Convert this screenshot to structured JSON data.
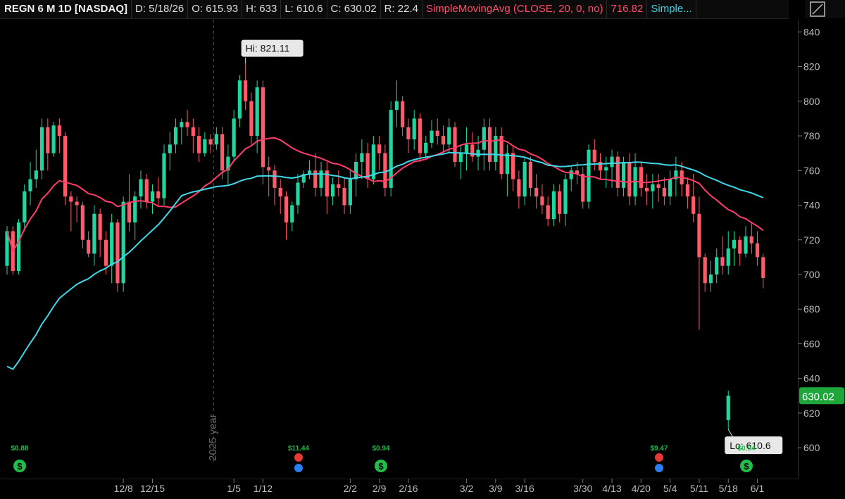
{
  "header": {
    "symbol": "REGN 6 M 1D [NASDAQ]",
    "date": "D: 5/18/26",
    "open": "O: 615.93",
    "high": "H: 633",
    "low": "L: 610.6",
    "close": "C: 630.02",
    "range": "R: 22.4",
    "sma20_label": "SimpleMovingAvg (CLOSE, 20, 0, no)",
    "sma20_value": "716.82",
    "sma50_label": "Simple..."
  },
  "colors": {
    "up": "#1fd6a0",
    "down": "#ff5a6a",
    "sma20": "#ff3d6a",
    "sma50": "#3fd8e8",
    "last_price_bg": "#1fa63a",
    "event_green": "#1fbf4a",
    "event_red": "#e53935",
    "event_blue": "#2a7ff0"
  },
  "chart_data": {
    "type": "candlestick",
    "ylim": [
      595,
      845
    ],
    "y_ticks": [
      600,
      620,
      640,
      660,
      680,
      700,
      720,
      740,
      760,
      780,
      800,
      820,
      840
    ],
    "x_ticks": [
      {
        "label": "12/8",
        "i": 20
      },
      {
        "label": "12/15",
        "i": 25
      },
      {
        "label": "1/5",
        "i": 39
      },
      {
        "label": "1/12",
        "i": 44
      },
      {
        "label": "2/2",
        "i": 59
      },
      {
        "label": "2/9",
        "i": 64
      },
      {
        "label": "2/16",
        "i": 69
      },
      {
        "label": "3/2",
        "i": 79
      },
      {
        "label": "3/9",
        "i": 84
      },
      {
        "label": "3/16",
        "i": 89
      },
      {
        "label": "3/30",
        "i": 99
      },
      {
        "label": "4/13",
        "i": 104
      },
      {
        "label": "4/20",
        "i": 109
      },
      {
        "label": "5/4",
        "i": 114
      },
      {
        "label": "5/11",
        "i": 119
      },
      {
        "label": "5/18",
        "i": 124
      },
      {
        "label": "6/1",
        "i": 129
      }
    ],
    "year_label": "2025 year",
    "year_divider_i": 35.5,
    "hi_label": "Hi: 821.11",
    "lo_label": "Lo: 610.6",
    "last_price": "630.02",
    "candles": [
      [
        705,
        728,
        700,
        725
      ],
      [
        725,
        728,
        700,
        702
      ],
      [
        702,
        732,
        700,
        730
      ],
      [
        730,
        752,
        725,
        748
      ],
      [
        748,
        765,
        740,
        755
      ],
      [
        755,
        772,
        750,
        760
      ],
      [
        760,
        790,
        755,
        785
      ],
      [
        785,
        790,
        760,
        770
      ],
      [
        770,
        788,
        768,
        786
      ],
      [
        786,
        790,
        770,
        780
      ],
      [
        780,
        782,
        740,
        745
      ],
      [
        745,
        748,
        725,
        742
      ],
      [
        742,
        745,
        730,
        740
      ],
      [
        740,
        742,
        715,
        720
      ],
      [
        720,
        725,
        710,
        712
      ],
      [
        712,
        740,
        705,
        735
      ],
      [
        735,
        738,
        710,
        720
      ],
      [
        720,
        725,
        700,
        705
      ],
      [
        705,
        735,
        695,
        730
      ],
      [
        730,
        732,
        690,
        695
      ],
      [
        695,
        745,
        690,
        742
      ],
      [
        742,
        758,
        725,
        730
      ],
      [
        730,
        748,
        720,
        745
      ],
      [
        745,
        760,
        738,
        755
      ],
      [
        755,
        758,
        738,
        742
      ],
      [
        742,
        752,
        735,
        748
      ],
      [
        748,
        756,
        740,
        744
      ],
      [
        744,
        775,
        740,
        770
      ],
      [
        770,
        782,
        760,
        775
      ],
      [
        775,
        790,
        770,
        785
      ],
      [
        785,
        790,
        775,
        788
      ],
      [
        788,
        795,
        780,
        785
      ],
      [
        785,
        790,
        770,
        780
      ],
      [
        780,
        785,
        765,
        770
      ],
      [
        770,
        782,
        768,
        778
      ],
      [
        778,
        781,
        770,
        775
      ],
      [
        775,
        785,
        772,
        781
      ],
      [
        781,
        785,
        755,
        760
      ],
      [
        760,
        775,
        752,
        768
      ],
      [
        768,
        795,
        765,
        790
      ],
      [
        790,
        815,
        785,
        812
      ],
      [
        812,
        822,
        795,
        800
      ],
      [
        800,
        805,
        775,
        780
      ],
      [
        780,
        812,
        770,
        808
      ],
      [
        808,
        812,
        752,
        762
      ],
      [
        762,
        768,
        745,
        760
      ],
      [
        760,
        763,
        740,
        750
      ],
      [
        750,
        755,
        735,
        745
      ],
      [
        745,
        748,
        720,
        730
      ],
      [
        730,
        742,
        725,
        740
      ],
      [
        740,
        758,
        735,
        753
      ],
      [
        753,
        760,
        750,
        758
      ],
      [
        758,
        766,
        755,
        760
      ],
      [
        760,
        770,
        745,
        750
      ],
      [
        750,
        765,
        745,
        760
      ],
      [
        760,
        765,
        735,
        745
      ],
      [
        745,
        756,
        740,
        752
      ],
      [
        752,
        760,
        745,
        750
      ],
      [
        750,
        756,
        735,
        740
      ],
      [
        740,
        760,
        735,
        755
      ],
      [
        755,
        770,
        745,
        765
      ],
      [
        765,
        778,
        755,
        770
      ],
      [
        770,
        776,
        750,
        755
      ],
      [
        755,
        780,
        752,
        775
      ],
      [
        775,
        780,
        760,
        770
      ],
      [
        770,
        775,
        745,
        750
      ],
      [
        750,
        800,
        745,
        795
      ],
      [
        795,
        812,
        785,
        800
      ],
      [
        800,
        803,
        780,
        785
      ],
      [
        785,
        790,
        770,
        778
      ],
      [
        778,
        795,
        772,
        790
      ],
      [
        790,
        793,
        765,
        770
      ],
      [
        770,
        780,
        768,
        776
      ],
      [
        776,
        789,
        773,
        783
      ],
      [
        783,
        790,
        775,
        780
      ],
      [
        780,
        786,
        770,
        775
      ],
      [
        775,
        790,
        770,
        785
      ],
      [
        785,
        788,
        762,
        765
      ],
      [
        765,
        775,
        755,
        770
      ],
      [
        770,
        785,
        760,
        775
      ],
      [
        775,
        782,
        765,
        768
      ],
      [
        768,
        780,
        760,
        772
      ],
      [
        772,
        790,
        760,
        785
      ],
      [
        785,
        790,
        760,
        765
      ],
      [
        765,
        785,
        760,
        780
      ],
      [
        780,
        785,
        755,
        758
      ],
      [
        758,
        775,
        745,
        770
      ],
      [
        770,
        774,
        748,
        755
      ],
      [
        755,
        760,
        738,
        745
      ],
      [
        745,
        768,
        740,
        765
      ],
      [
        765,
        768,
        745,
        750
      ],
      [
        750,
        758,
        738,
        745
      ],
      [
        745,
        752,
        735,
        740
      ],
      [
        740,
        745,
        728,
        732
      ],
      [
        732,
        752,
        728,
        748
      ],
      [
        748,
        752,
        730,
        735
      ],
      [
        735,
        758,
        728,
        755
      ],
      [
        755,
        762,
        748,
        760
      ],
      [
        760,
        765,
        752,
        758
      ],
      [
        758,
        762,
        738,
        742
      ],
      [
        742,
        775,
        738,
        772
      ],
      [
        772,
        778,
        760,
        765
      ],
      [
        765,
        770,
        755,
        760
      ],
      [
        760,
        768,
        750,
        762
      ],
      [
        762,
        772,
        750,
        768
      ],
      [
        768,
        771,
        745,
        750
      ],
      [
        750,
        768,
        745,
        765
      ],
      [
        765,
        770,
        740,
        745
      ],
      [
        745,
        770,
        740,
        762
      ],
      [
        762,
        765,
        745,
        750
      ],
      [
        750,
        758,
        740,
        748
      ],
      [
        748,
        758,
        738,
        752
      ],
      [
        752,
        758,
        742,
        750
      ],
      [
        750,
        756,
        740,
        745
      ],
      [
        745,
        760,
        740,
        755
      ],
      [
        755,
        768,
        745,
        760
      ],
      [
        760,
        765,
        745,
        752
      ],
      [
        752,
        756,
        738,
        745
      ],
      [
        745,
        758,
        730,
        735
      ],
      [
        735,
        745,
        668,
        710
      ],
      [
        710,
        712,
        690,
        695
      ],
      [
        695,
        708,
        690,
        700
      ],
      [
        700,
        715,
        695,
        710
      ],
      [
        710,
        722,
        700,
        705
      ],
      [
        705,
        725,
        700,
        715
      ],
      [
        715,
        725,
        705,
        720
      ],
      [
        720,
        722,
        705,
        712
      ],
      [
        712,
        728,
        710,
        722
      ],
      [
        722,
        730,
        712,
        718
      ],
      [
        718,
        725,
        705,
        710
      ],
      [
        710,
        712,
        692,
        698
      ]
    ],
    "last_candle": {
      "i": 124,
      "ohlc": [
        615.93,
        633,
        610.6,
        630.02
      ]
    },
    "series": [
      {
        "name": "SimpleMovingAvg (CLOSE, 20, 0, no)"
      },
      {
        "name": "Simple..."
      }
    ],
    "events": [
      {
        "i": 3,
        "label": "$0.88",
        "kind": "dividend"
      },
      {
        "i": 61,
        "label": "$11.44",
        "kind": "earnings"
      },
      {
        "i": 76,
        "label": "$0.94",
        "kind": "dividend"
      },
      {
        "i": 131.3,
        "label": "$9.47",
        "kind": "earnings"
      },
      {
        "i": 148.5,
        "label": "$0.94",
        "kind": "dividend"
      }
    ]
  }
}
